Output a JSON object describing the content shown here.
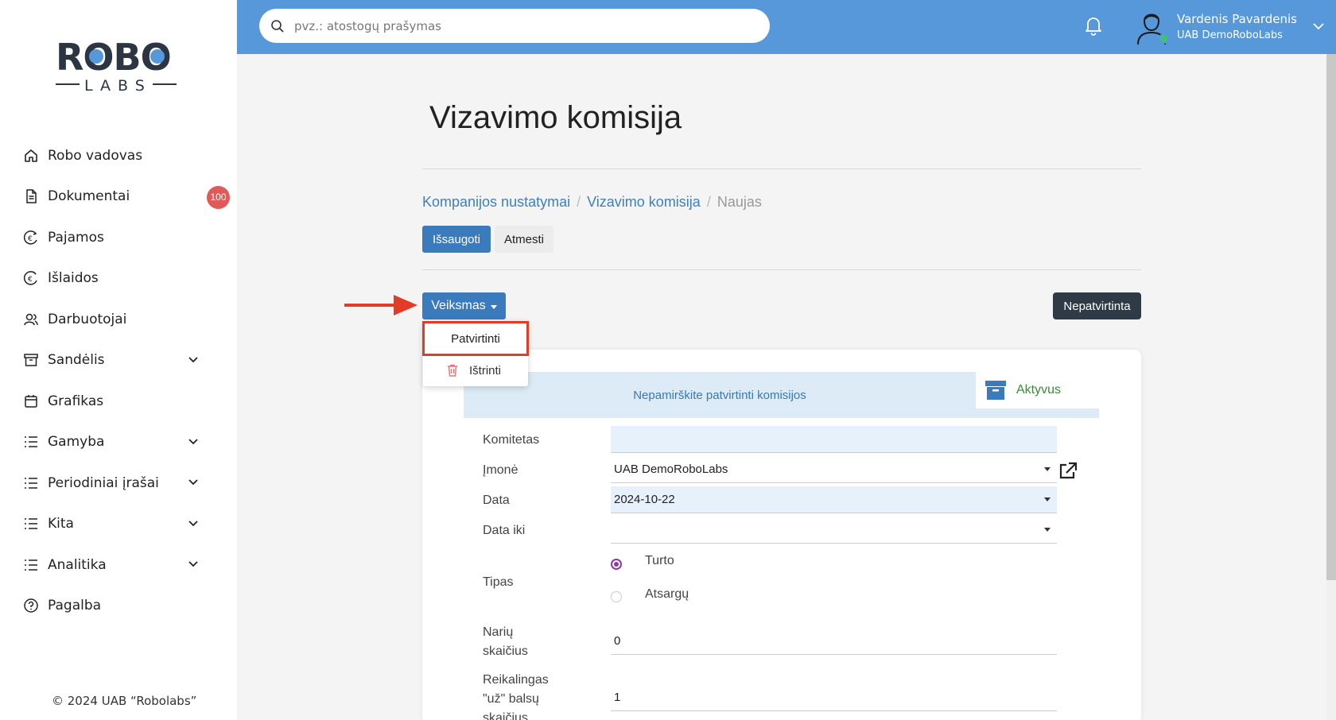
{
  "sidebar": {
    "logo_top": "ROBO",
    "logo_bottom": "LABS",
    "items": [
      {
        "label": "Robo vadovas",
        "icon": "home-icon"
      },
      {
        "label": "Dokumentai",
        "icon": "document-icon",
        "badge": "100"
      },
      {
        "label": "Pajamos",
        "icon": "income-icon"
      },
      {
        "label": "Išlaidos",
        "icon": "expenses-icon"
      },
      {
        "label": "Darbuotojai",
        "icon": "employees-icon"
      },
      {
        "label": "Sandėlis",
        "icon": "warehouse-icon"
      },
      {
        "label": "Grafikas",
        "icon": "calendar-icon"
      },
      {
        "label": "Gamyba",
        "icon": "list-icon"
      },
      {
        "label": "Periodiniai įrašai",
        "icon": "list-icon"
      },
      {
        "label": "Kita",
        "icon": "list-icon"
      },
      {
        "label": "Analitika",
        "icon": "list-icon"
      },
      {
        "label": "Pagalba",
        "icon": "help-icon"
      }
    ],
    "copyright": "© 2024 UAB “Robolabs”"
  },
  "header": {
    "search_placeholder": "pvz.: atostogų prašymas",
    "user_name": "Vardenis Pavardenis",
    "user_company": "UAB DemoRoboLabs"
  },
  "main": {
    "title": "Vizavimo komisija",
    "breadcrumb": [
      "Kompanijos nustatymai",
      "Vizavimo komisija",
      "Naujas"
    ],
    "breadcrumb_sep": "/",
    "save_label": "Išsaugoti",
    "discard_label": "Atmesti",
    "action_label": "Veiksmas",
    "status_label": "Nepatvirtinta",
    "dropdown": {
      "confirm": "Patvirtinti",
      "delete": "Ištrinti"
    },
    "alert_text": "Nepamirškite patvirtinti komisijos",
    "archive_label": "Aktyvus",
    "form": {
      "committee_label": "Komitetas",
      "committee_value": "",
      "company_label": "Įmonė",
      "company_value": "UAB DemoRoboLabs",
      "date_label": "Data",
      "date_value": "2024-10-22",
      "date_to_label": "Data iki",
      "date_to_value": "",
      "type_label": "Tipas",
      "type_option_1": "Turto",
      "type_option_2": "Atsargų",
      "members_label_1": "Narių",
      "members_label_2": "skaičius",
      "members_value": "0",
      "votes_label_1": "Reikalingas",
      "votes_label_2": "\"už\" balsų",
      "votes_label_3": "skaičius",
      "votes_value": "1"
    }
  },
  "colors": {
    "header": "#5698d9",
    "primary_button": "#3a7bbd",
    "badge": "#e05a5a",
    "highlight": "#e23b26",
    "status_dark": "#2e3b47"
  }
}
